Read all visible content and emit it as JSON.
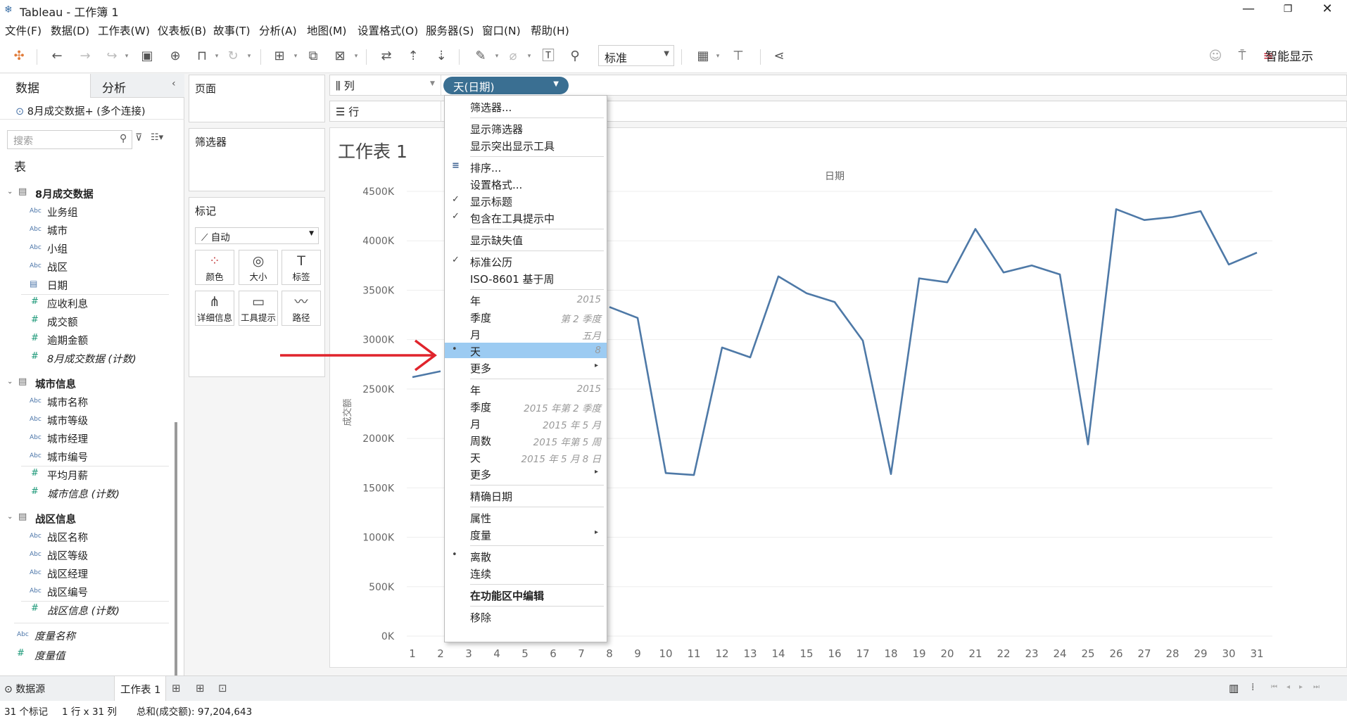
{
  "window": {
    "title": "Tableau - 工作簿 1",
    "min": "—",
    "max": "❐",
    "close": "✕"
  },
  "menubar": [
    "文件(F)",
    "数据(D)",
    "工作表(W)",
    "仪表板(B)",
    "故事(T)",
    "分析(A)",
    "地图(M)",
    "设置格式(O)",
    "服务器(S)",
    "窗口(N)",
    "帮助(H)"
  ],
  "toolbar": {
    "standard": "标准",
    "smart_show": "智能显示"
  },
  "left_pane": {
    "tab_data": "数据",
    "tab_analysis": "分析",
    "connection": "8月成交数据+ (多个连接)",
    "search_placeholder": "搜索",
    "tables_label": "表",
    "groups": [
      {
        "name": "8月成交数据",
        "dims": [
          {
            "t": "Abc",
            "n": "业务组"
          },
          {
            "t": "Abc",
            "n": "城市"
          },
          {
            "t": "Abc",
            "n": "小组"
          },
          {
            "t": "Abc",
            "n": "战区"
          },
          {
            "t": "cal",
            "n": "日期"
          }
        ],
        "measures": [
          {
            "n": "应收利息"
          },
          {
            "n": "成交额"
          },
          {
            "n": "逾期金额"
          },
          {
            "n": "8月成交数据 (计数)",
            "i": true
          }
        ]
      },
      {
        "name": "城市信息",
        "dims": [
          {
            "t": "Abc",
            "n": "城市名称"
          },
          {
            "t": "Abc",
            "n": "城市等级"
          },
          {
            "t": "Abc",
            "n": "城市经理"
          },
          {
            "t": "Abc",
            "n": "城市编号"
          }
        ],
        "measures": [
          {
            "n": "平均月薪"
          },
          {
            "n": "城市信息 (计数)",
            "i": true
          }
        ]
      },
      {
        "name": "战区信息",
        "dims": [
          {
            "t": "Abc",
            "n": "战区名称"
          },
          {
            "t": "Abc",
            "n": "战区等级"
          },
          {
            "t": "Abc",
            "n": "战区经理"
          },
          {
            "t": "Abc",
            "n": "战区编号"
          }
        ],
        "measures": [
          {
            "n": "战区信息 (计数)",
            "i": true
          }
        ]
      }
    ],
    "extra": [
      {
        "t": "Abc",
        "n": "度量名称"
      },
      {
        "t": "#",
        "n": "度量值"
      }
    ]
  },
  "cards": {
    "pages": "页面",
    "filters": "筛选器",
    "marks": "标记",
    "marks_type": "自动",
    "mark_buttons": [
      {
        "g": "⁘",
        "l": "颜色"
      },
      {
        "g": "◎",
        "l": "大小"
      },
      {
        "g": "T",
        "l": "标签"
      },
      {
        "g": "⋔",
        "l": "详细信息"
      },
      {
        "g": "▭",
        "l": "工具提示"
      },
      {
        "g": "〰",
        "l": "路径"
      }
    ]
  },
  "shelves": {
    "columns": "列",
    "rows": "行",
    "pill": "天(日期)"
  },
  "sheet": {
    "title": "工作表 1",
    "tab": "工作表 1",
    "datasource": "数据源"
  },
  "context_menu": [
    {
      "t": "筛选器..."
    },
    {
      "sep": true
    },
    {
      "t": "显示筛选器"
    },
    {
      "t": "显示突出显示工具"
    },
    {
      "sep": true
    },
    {
      "t": "排序...",
      "icon": "sort"
    },
    {
      "t": "设置格式..."
    },
    {
      "t": "显示标题",
      "check": "✓"
    },
    {
      "t": "包含在工具提示中",
      "check": "✓"
    },
    {
      "sep": true
    },
    {
      "t": "显示缺失值"
    },
    {
      "sep": true
    },
    {
      "t": "标准公历",
      "check": "✓"
    },
    {
      "t": "ISO-8601 基于周"
    },
    {
      "sep": true
    },
    {
      "t": "年",
      "hint": "2015"
    },
    {
      "t": "季度",
      "hint": "第 2 季度"
    },
    {
      "t": "月",
      "hint": "五月"
    },
    {
      "t": "天",
      "hint": "8",
      "check": "•",
      "selected": true
    },
    {
      "t": "更多",
      "sub": true
    },
    {
      "sep": true
    },
    {
      "t": "年",
      "hint": "2015"
    },
    {
      "t": "季度",
      "hint": "2015 年第 2 季度"
    },
    {
      "t": "月",
      "hint": "2015 年 5 月"
    },
    {
      "t": "周数",
      "hint": "2015 年第 5 周"
    },
    {
      "t": "天",
      "hint": "2015 年 5 月 8 日"
    },
    {
      "t": "更多",
      "sub": true
    },
    {
      "sep": true
    },
    {
      "t": "精确日期"
    },
    {
      "sep": true
    },
    {
      "t": "属性"
    },
    {
      "t": "度量",
      "sub": true
    },
    {
      "sep": true
    },
    {
      "t": "离散",
      "check": "•"
    },
    {
      "t": "连续"
    },
    {
      "sep": true
    },
    {
      "t": "在功能区中编辑",
      "bold": true
    },
    {
      "sep": true
    },
    {
      "t": "移除"
    }
  ],
  "status": {
    "marks": "31 个标记",
    "dims": "1 行 x 31 列",
    "sum": "总和(成交额): 97,204,643"
  },
  "chart_data": {
    "type": "line",
    "xlabel": "日期",
    "ylabel": "成交额",
    "categories": [
      1,
      2,
      3,
      4,
      5,
      6,
      7,
      8,
      9,
      10,
      11,
      12,
      13,
      14,
      15,
      16,
      17,
      18,
      19,
      20,
      21,
      22,
      23,
      24,
      25,
      26,
      27,
      28,
      29,
      30,
      31
    ],
    "values": [
      2620,
      2680,
      null,
      null,
      null,
      null,
      null,
      3330,
      3220,
      1650,
      1630,
      2920,
      2820,
      3640,
      3470,
      3380,
      2990,
      1640,
      3620,
      3580,
      4120,
      3680,
      3750,
      3660,
      1940,
      4320,
      4210,
      4240,
      4300,
      3760,
      3880
    ],
    "yticks": [
      "0K",
      "500K",
      "1000K",
      "1500K",
      "2000K",
      "2500K",
      "3000K",
      "3500K",
      "4000K",
      "4500K"
    ],
    "ylim": [
      0,
      4500
    ],
    "color": "#4e79a7"
  }
}
